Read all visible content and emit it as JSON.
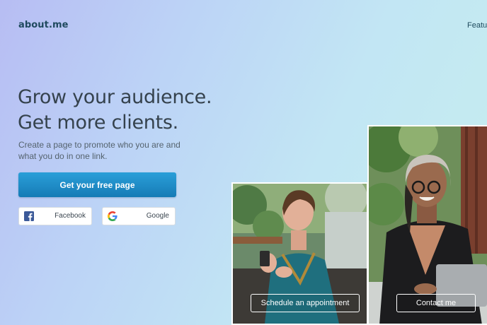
{
  "header": {
    "logo": "about.me",
    "nav_item": "Featu"
  },
  "hero": {
    "headline_line1": "Grow your audience.",
    "headline_line2": "Get more clients.",
    "subtitle": "Create a page to promote who you are and what you do in one link.",
    "cta_label": "Get your free page"
  },
  "signup": {
    "facebook_label": "Facebook",
    "google_label": "Google"
  },
  "showcase": {
    "left_button": "Schedule an appointment",
    "right_button": "Contact me"
  },
  "colors": {
    "cta": "#1f8bc6",
    "logo": "#1f4a5e",
    "headline": "#35424d",
    "facebook": "#3b5998"
  },
  "icons": [
    "facebook-icon",
    "google-icon"
  ]
}
